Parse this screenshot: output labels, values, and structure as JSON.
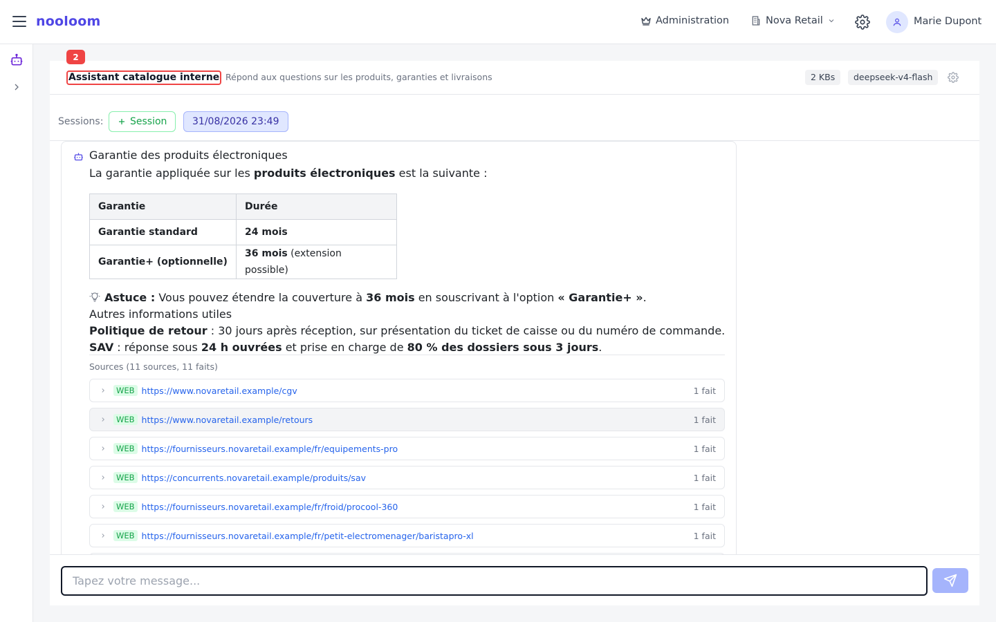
{
  "app": {
    "brand": "nooloom"
  },
  "topbar": {
    "admin_label": "Administration",
    "org_label": "Nova Retail",
    "user_name": "Marie Dupont"
  },
  "agent": {
    "notification_count": "2",
    "title": "Assistant catalogue interne",
    "description": "Répond aux questions sur les produits, garanties et livraisons",
    "kb_chip": "2 KBs",
    "model_chip": "deepseek-v4-flash"
  },
  "sessions": {
    "label": "Sessions:",
    "new_label": "Session",
    "active_session": "31/08/2026 23:49"
  },
  "message": {
    "title": "Garantie des produits électroniques",
    "intro_before": "La garantie appliquée sur les ",
    "intro_bold": "produits électroniques",
    "intro_after": " est la suivante :",
    "table": {
      "headers": [
        "Garantie",
        "Durée"
      ],
      "rows": [
        {
          "label": "Garantie standard",
          "duration_bold": "24 mois",
          "duration_note": ""
        },
        {
          "label": "Garantie+ (optionnelle)",
          "duration_bold": "36 mois",
          "duration_note": " (extension possible)"
        }
      ]
    },
    "tip": {
      "prefix_bold": "Astuce :",
      "text_1": " Vous pouvez étendre la couverture à ",
      "bold_1": "36 mois",
      "text_2": " en souscrivant à l'option ",
      "bold_2": "« Garantie+ »",
      "text_3": "."
    },
    "other_heading": "Autres informations utiles",
    "return_policy": {
      "label_bold": "Politique de retour",
      "text": " : 30 jours après réception, sur présentation du ticket de caisse ou du numéro de commande."
    },
    "sav": {
      "label_bold": "SAV",
      "text_1": " : réponse sous ",
      "bold_1": "24 h ouvrées",
      "text_2": " et prise en charge de ",
      "bold_2": "80 % des dossiers sous 3 jours",
      "text_3": "."
    }
  },
  "sources": {
    "label": "Sources (11 sources, 11 faits)",
    "items": [
      {
        "tag": "WEB",
        "url": "https://www.novaretail.example/cgv",
        "count": "1 fait"
      },
      {
        "tag": "WEB",
        "url": "https://www.novaretail.example/retours",
        "count": "1 fait"
      },
      {
        "tag": "WEB",
        "url": "https://fournisseurs.novaretail.example/fr/equipements-pro",
        "count": "1 fait"
      },
      {
        "tag": "WEB",
        "url": "https://concurrents.novaretail.example/produits/sav",
        "count": "1 fait"
      },
      {
        "tag": "WEB",
        "url": "https://fournisseurs.novaretail.example/fr/froid/procool-360",
        "count": "1 fait"
      },
      {
        "tag": "WEB",
        "url": "https://fournisseurs.novaretail.example/fr/petit-electromenager/baristapro-xl",
        "count": "1 fait"
      }
    ]
  },
  "composer": {
    "placeholder": "Tapez votre message..."
  },
  "colors": {
    "brand": "#4f46e5",
    "alert": "#ef4444",
    "success": "#16a34a",
    "link": "#2563eb"
  },
  "icons": [
    "menu-icon",
    "crown-icon",
    "building-icon",
    "chevron-down-icon",
    "gear-icon",
    "user-icon",
    "bot-icon",
    "chevron-right-icon",
    "plus-icon",
    "lightbulb-icon",
    "send-icon"
  ]
}
